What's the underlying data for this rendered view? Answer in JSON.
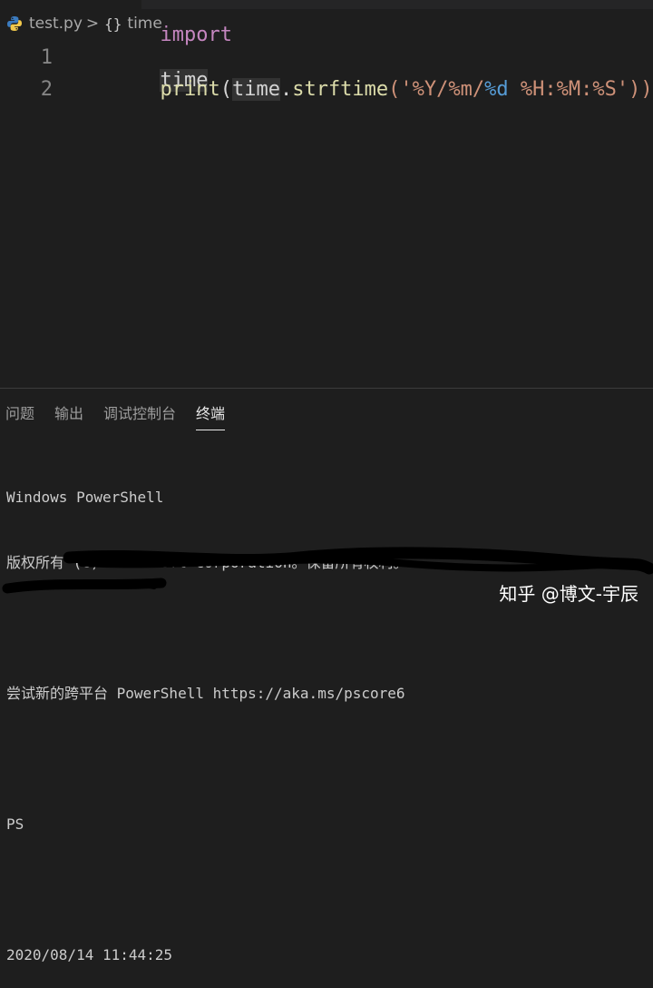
{
  "breadcrumb": {
    "file": "test.py",
    "separator": ">",
    "symbol_icon": "{}",
    "symbol": "time"
  },
  "editor": {
    "lines": [
      {
        "number": "1",
        "keyword": "import",
        "rest": "time"
      },
      {
        "number": "2",
        "fn": "print",
        "open": "(",
        "var": "time",
        "dot": ".",
        "method": "strftime",
        "open2": "('",
        "fmt1": "%Y/%m/",
        "fmt_esc": "%d",
        "fmt2": " %H:%M:%S",
        "close": "'))"
      }
    ]
  },
  "panel": {
    "tabs": [
      {
        "label": "问题"
      },
      {
        "label": "输出"
      },
      {
        "label": "调试控制台"
      },
      {
        "label": "终端",
        "active": true
      }
    ]
  },
  "terminal": {
    "lines": [
      "Windows PowerShell",
      "版权所有 (C) Microsoft Corporation。保留所有权利。",
      "",
      "尝试新的跨平台 PowerShell https://aka.ms/pscore6",
      "",
      "PS",
      "",
      "2020/08/14 11:44:25"
    ]
  },
  "watermark": "知乎 @博文-宇辰",
  "colors": {
    "background": "#1e1e1e",
    "keyword": "#c586c0",
    "function": "#dcdcaa",
    "string": "#ce9178",
    "escape": "#569cd6"
  }
}
